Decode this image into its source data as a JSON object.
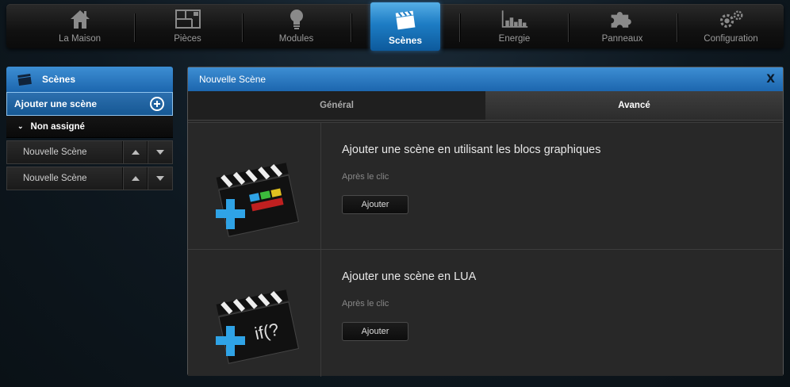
{
  "nav": {
    "items": [
      {
        "label": "La Maison",
        "icon": "house-icon"
      },
      {
        "label": "Pièces",
        "icon": "floorplan-icon"
      },
      {
        "label": "Modules",
        "icon": "lightbulb-icon"
      },
      {
        "label": "Scènes",
        "icon": "clapperboard-icon"
      },
      {
        "label": "Energie",
        "icon": "bar-chart-icon"
      },
      {
        "label": "Panneaux",
        "icon": "puzzle-icon"
      },
      {
        "label": "Configuration",
        "icon": "gears-icon"
      }
    ],
    "active": "Scènes"
  },
  "sidebar": {
    "title": "Scènes",
    "add_label": "Ajouter une scène",
    "group_label": "Non assigné",
    "scenes": [
      {
        "label": "Nouvelle Scène"
      },
      {
        "label": "Nouvelle Scène"
      }
    ]
  },
  "main": {
    "title": "Nouvelle Scène",
    "close_label": "X",
    "tabs": [
      {
        "label": "Général"
      },
      {
        "label": "Avancé"
      }
    ],
    "active_tab": "Avancé",
    "options": [
      {
        "title": "Ajouter une scène en utilisant les blocs graphiques",
        "subtitle": "Après le clic",
        "button": "Ajouter",
        "overlay": ""
      },
      {
        "title": "Ajouter une scène en LUA",
        "subtitle": "Après le clic",
        "button": "Ajouter",
        "overlay": "if(?"
      }
    ]
  },
  "colors": {
    "accent_blue": "#1d7cc4",
    "plus_blue": "#2fa3e6"
  }
}
